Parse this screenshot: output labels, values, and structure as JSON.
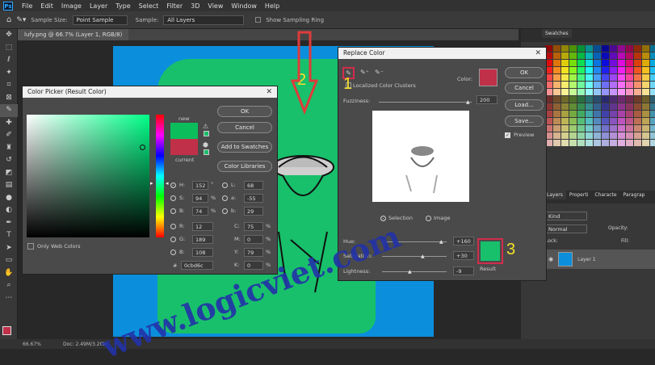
{
  "app": {
    "logo": "Ps"
  },
  "menu": [
    "File",
    "Edit",
    "Image",
    "Layer",
    "Type",
    "Select",
    "Filter",
    "3D",
    "View",
    "Window",
    "Help"
  ],
  "options": {
    "sample_size_label": "Sample Size:",
    "sample_size_value": "Point Sample",
    "sample_label": "Sample:",
    "sample_value": "All Layers",
    "show_ring_label": "Show Sampling Ring"
  },
  "document": {
    "tab_label": "lufy.png @ 66.7% (Layer 1, RGB/8)"
  },
  "status": {
    "zoom": "66.67%",
    "doc": "Doc: 2.49M/3.20M"
  },
  "color_picker": {
    "title": "Color Picker (Result Color)",
    "new_label": "new",
    "current_label": "current",
    "new_color": "#0cbd5c",
    "current_color": "#c03048",
    "ok": "OK",
    "cancel": "Cancel",
    "add_to_swatches": "Add to Swatches",
    "color_libraries": "Color Libraries",
    "only_web": "Only Web Colors",
    "H": {
      "label": "H:",
      "value": "152",
      "unit": "°"
    },
    "S": {
      "label": "S:",
      "value": "94",
      "unit": "%"
    },
    "B": {
      "label": "B:",
      "value": "74",
      "unit": "%"
    },
    "R": {
      "label": "R:",
      "value": "12"
    },
    "G": {
      "label": "G:",
      "value": "189"
    },
    "Bl": {
      "label": "B:",
      "value": "108"
    },
    "L": {
      "label": "L:",
      "value": "68"
    },
    "a": {
      "label": "a:",
      "value": "-55"
    },
    "b": {
      "label": "b:",
      "value": "29"
    },
    "C": {
      "label": "C:",
      "value": "75",
      "unit": "%"
    },
    "M": {
      "label": "M:",
      "value": "0",
      "unit": "%"
    },
    "Y": {
      "label": "Y:",
      "value": "79",
      "unit": "%"
    },
    "K": {
      "label": "K:",
      "value": "0",
      "unit": "%"
    },
    "hex_label": "#",
    "hex_value": "0cbd6c"
  },
  "replace_color": {
    "title": "Replace Color",
    "localized": "Localized Color Clusters",
    "color_label": "Color:",
    "color_swatch": "#c03048",
    "fuzziness_label": "Fuzziness:",
    "fuzziness_value": "200",
    "fuzziness_pos": 1.0,
    "ok": "OK",
    "cancel": "Cancel",
    "load": "Load...",
    "save": "Save...",
    "preview": "Preview",
    "selection": "Selection",
    "image": "Image",
    "hue_label": "Hue:",
    "hue_value": "+160",
    "sat_label": "Saturation:",
    "sat_value": "+30",
    "light_label": "Lightness:",
    "light_value": "-9",
    "result_label": "Result",
    "result_color": "#18c06b"
  },
  "annotations": {
    "n1": "1",
    "n2": "2",
    "n3": "3",
    "watermark": "www.logicviet.com"
  },
  "panels": {
    "swatches_tab": "Swatches",
    "layers_tabs": [
      "Layers",
      "Properti",
      "Characte",
      "Paragrap"
    ],
    "kind_label": "Kind",
    "normal_label": "Normal",
    "opacity_label": "Opacity:",
    "lock_label": "Lock:",
    "fill_label": "Fill:",
    "layer_name": "Layer 1"
  }
}
